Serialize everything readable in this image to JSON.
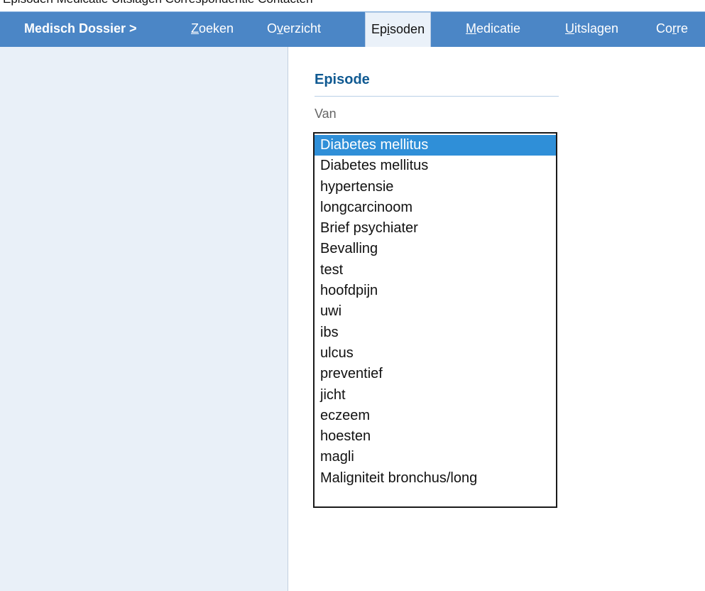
{
  "topbar": {
    "partial_text": "Episoden Medicatie Uitslagen Correspondentie Contacten"
  },
  "nav": {
    "breadcrumb": {
      "label": "Medisch Dossier >"
    },
    "tabs": [
      {
        "pre": "",
        "u": "Z",
        "post": "oeken"
      },
      {
        "pre": "O",
        "u": "v",
        "post": "erzicht"
      },
      {
        "pre": "Ep",
        "u": "i",
        "post": "soden"
      },
      {
        "pre": "",
        "u": "M",
        "post": "edicatie"
      },
      {
        "pre": "",
        "u": "U",
        "post": "itslagen"
      },
      {
        "pre": "Co",
        "u": "r",
        "post": "re"
      }
    ],
    "active_tab": "Episoden"
  },
  "episode": {
    "title": "Episode",
    "from_label": "Van",
    "selected_index": 0,
    "items": [
      "Diabetes mellitus",
      "Diabetes mellitus",
      "hypertensie",
      "longcarcinoom",
      "Brief psychiater",
      "Bevalling",
      "test",
      "hoofdpijn",
      "uwi",
      "ibs",
      "ulcus",
      "preventief",
      "jicht",
      "eczeem",
      "hoesten",
      "magli",
      "Maligniteit bronchus/long"
    ]
  },
  "colors": {
    "navbar": "#4b86c6",
    "sidebar": "#e9f0f8",
    "title": "#105a92",
    "selection": "#2f8fd8"
  }
}
